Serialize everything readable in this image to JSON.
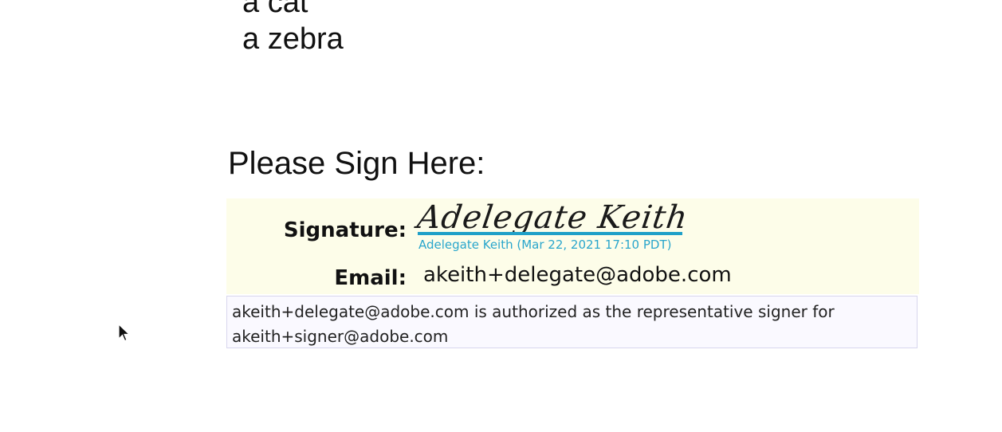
{
  "document": {
    "list_items": [
      "a cat",
      "a zebra"
    ],
    "heading": "Please Sign Here:"
  },
  "signature_block": {
    "signature_label": "Signature:",
    "signature_script": "Adelegate Keith",
    "signature_caption": "Adelegate Keith (Mar 22, 2021 17:10 PDT)",
    "email_label": "Email:",
    "email_value": "akeith+delegate@adobe.com"
  },
  "authorization_note": {
    "line1": "akeith+delegate@adobe.com is authorized as the representative signer for",
    "line2": "akeith+signer@adobe.com"
  },
  "colors": {
    "signature_accent": "#1fa0c8",
    "block_background": "#fdfde9",
    "note_background": "#faf9ff"
  },
  "icons": {
    "cursor": "mouse-pointer-icon"
  }
}
